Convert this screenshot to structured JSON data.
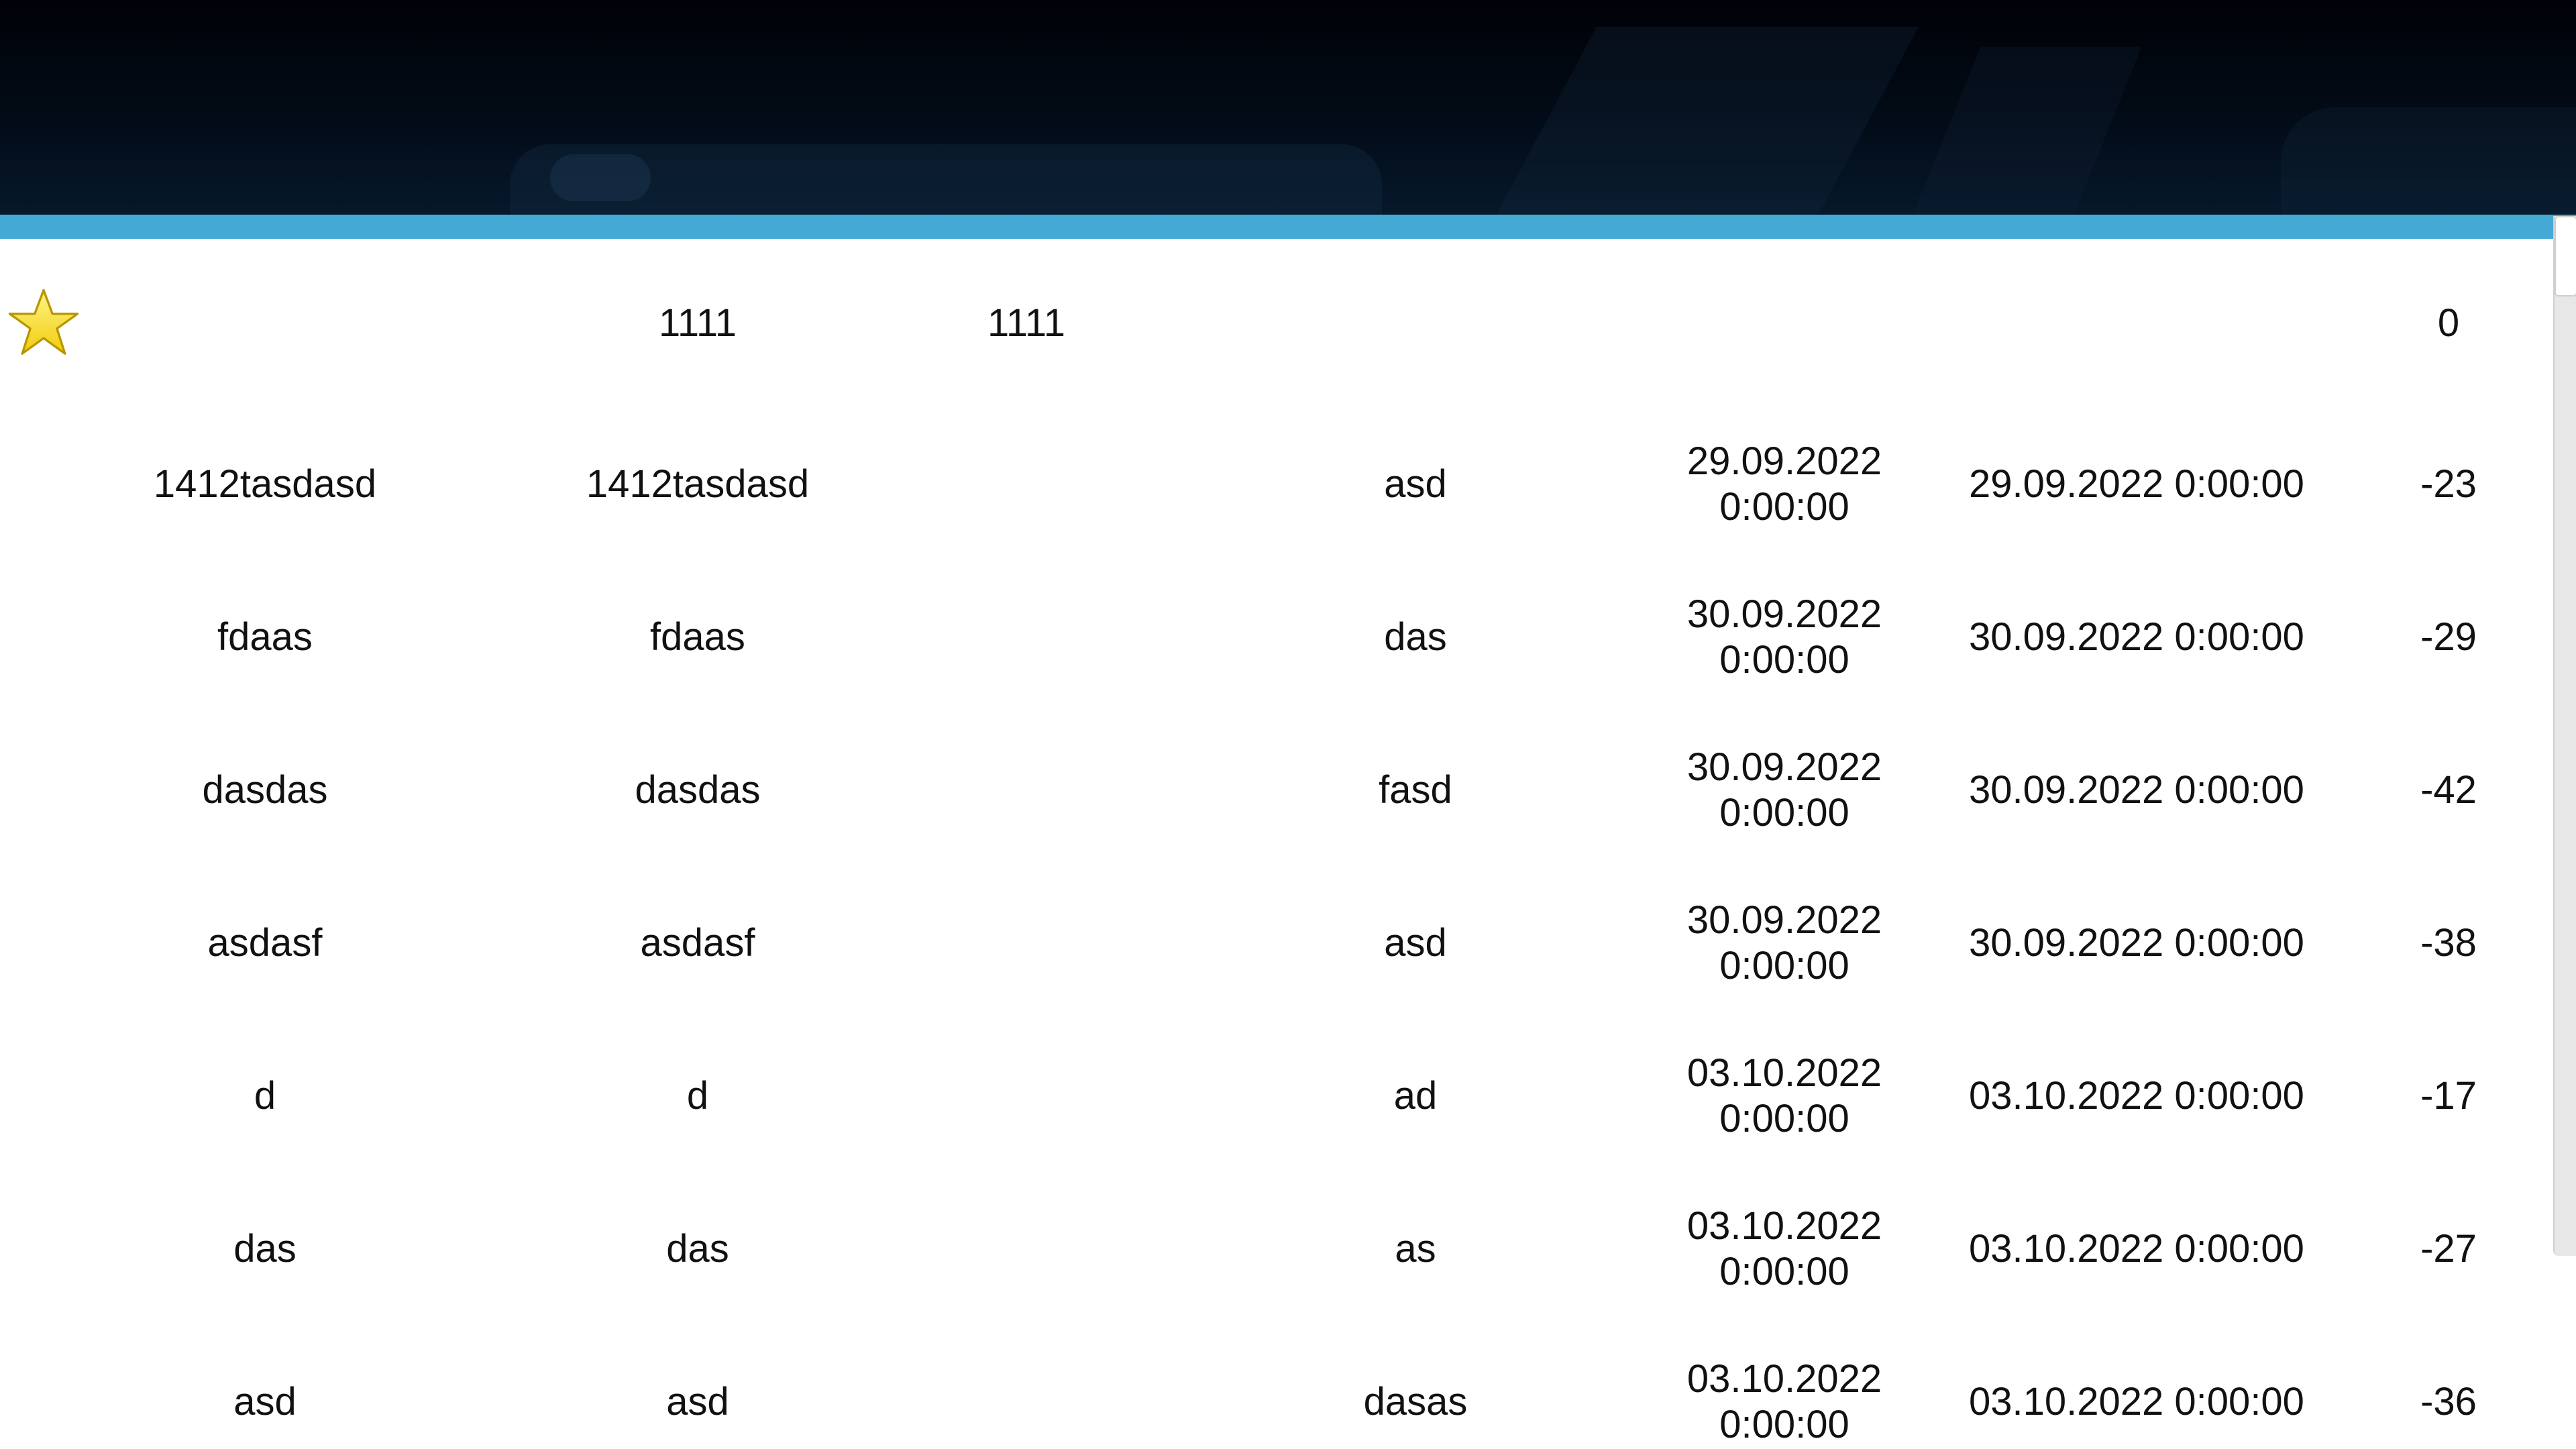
{
  "header": {
    "accent_color": "#45a9d6",
    "background_color": "#020b17"
  },
  "table": {
    "pinned_row": {
      "icon": "star-icon",
      "icon_color": "#f5d614",
      "col2": "1111",
      "col3": "1111",
      "col7": "0"
    },
    "rows": [
      {
        "col1": "1412tasdasd",
        "col2": "1412tasdasd",
        "col4": "asd",
        "col5": "29.09.2022 0:00:00",
        "col6": "29.09.2022 0:00:00",
        "col7": "-23"
      },
      {
        "col1": "fdaas",
        "col2": "fdaas",
        "col4": "das",
        "col5": "30.09.2022 0:00:00",
        "col6": "30.09.2022 0:00:00",
        "col7": "-29"
      },
      {
        "col1": "dasdas",
        "col2": "dasdas",
        "col4": "fasd",
        "col5": "30.09.2022 0:00:00",
        "col6": "30.09.2022 0:00:00",
        "col7": "-42"
      },
      {
        "col1": "asdasf",
        "col2": "asdasf",
        "col4": "asd",
        "col5": "30.09.2022 0:00:00",
        "col6": "30.09.2022 0:00:00",
        "col7": "-38"
      },
      {
        "col1": "d",
        "col2": "d",
        "col4": "ad",
        "col5": "03.10.2022 0:00:00",
        "col6": "03.10.2022 0:00:00",
        "col7": "-17"
      },
      {
        "col1": "das",
        "col2": "das",
        "col4": "as",
        "col5": "03.10.2022 0:00:00",
        "col6": "03.10.2022 0:00:00",
        "col7": "-27"
      },
      {
        "col1": "asd",
        "col2": "asd",
        "col4": "dasas",
        "col5": "03.10.2022 0:00:00",
        "col6": "03.10.2022 0:00:00",
        "col7": "-36"
      }
    ]
  }
}
